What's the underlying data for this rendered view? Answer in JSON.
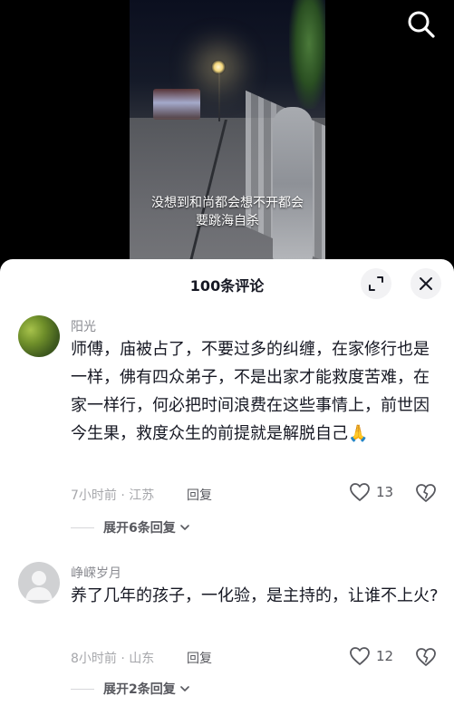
{
  "video": {
    "caption_line1": "没想到和尚都会想不开都会",
    "caption_line2": "要跳海自杀",
    "search_icon": "search-icon"
  },
  "sheet": {
    "title": "100条评论",
    "expand_icon": "expand-icon",
    "close_icon": "close-icon"
  },
  "comments": [
    {
      "username": "阳光",
      "text": "师傅，庙被占了，不要过多的纠缠，在家修行也是一样，佛有四众弟子，不是出家才能救度苦难，在家一样行，何必把时间浪费在这些事情上，前世因今生果，救度众生的前提就是解脱自己🙏",
      "time_location": "7小时前 · 江苏",
      "reply_label": "回复",
      "likes": "13",
      "expand_replies": "展开6条回复"
    },
    {
      "username": "峥嵘岁月",
      "text": "养了几年的孩子，一化验，是主持的，让谁不上火?",
      "time_location": "8小时前 · 山东",
      "reply_label": "回复",
      "likes": "12",
      "expand_replies": "展开2条回复"
    }
  ],
  "colors": {
    "text_primary": "#161823",
    "text_secondary": "#8a8b91",
    "background": "#ffffff",
    "video_bg": "#000000"
  }
}
